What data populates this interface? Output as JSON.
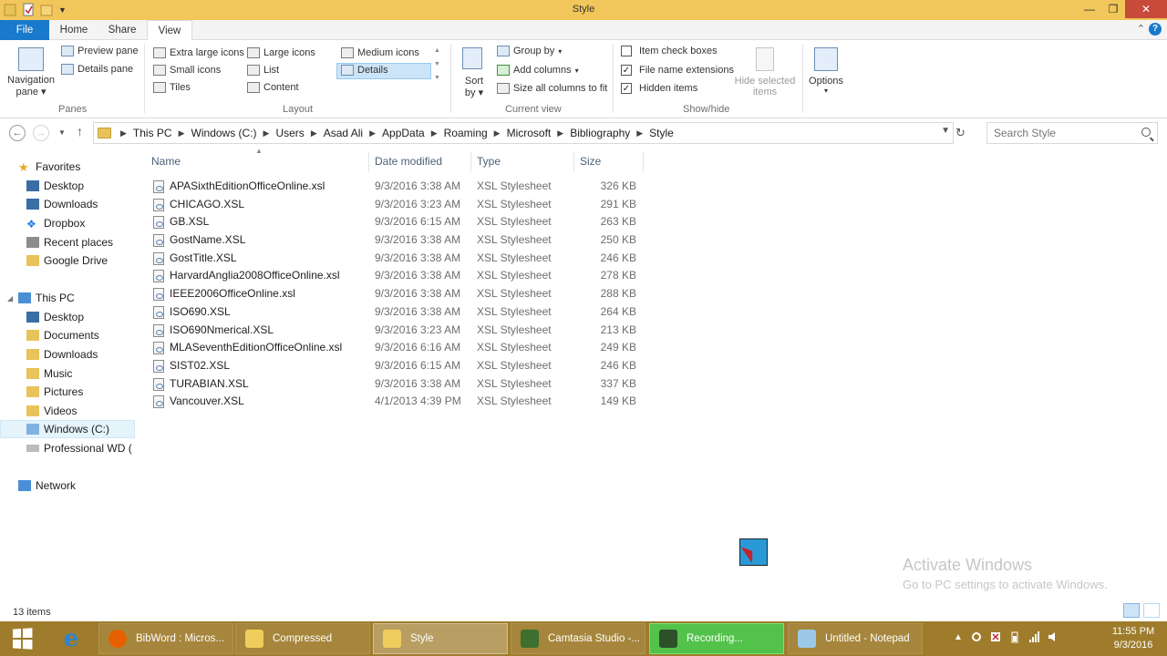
{
  "window": {
    "title": "Style"
  },
  "ribbon": {
    "tabs": [
      "File",
      "Home",
      "Share",
      "View"
    ],
    "panes": {
      "navigation_pane": "Navigation",
      "navigation_pane_line2": "pane",
      "preview_pane": "Preview pane",
      "details_pane": "Details pane",
      "group_label": "Panes"
    },
    "layout": {
      "extra_large_icons": "Extra large icons",
      "large_icons": "Large icons",
      "medium_icons": "Medium icons",
      "small_icons": "Small icons",
      "list": "List",
      "details": "Details",
      "tiles": "Tiles",
      "content": "Content",
      "group_label": "Layout",
      "selected": "Details"
    },
    "current_view": {
      "sort_by": "Sort",
      "sort_by_line2": "by",
      "group_by": "Group by",
      "add_columns": "Add columns",
      "size_all_columns": "Size all columns to fit",
      "group_label": "Current view"
    },
    "show_hide": {
      "item_check_boxes": "Item check boxes",
      "item_check_boxes_checked": false,
      "file_name_extensions": "File name extensions",
      "file_name_extensions_checked": true,
      "hidden_items": "Hidden items",
      "hidden_items_checked": true,
      "hide_selected_items": "Hide selected",
      "hide_selected_items_line2": "items",
      "group_label": "Show/hide"
    },
    "options": "Options"
  },
  "address": {
    "breadcrumbs": [
      "This PC",
      "Windows (C:)",
      "Users",
      "Asad Ali",
      "AppData",
      "Roaming",
      "Microsoft",
      "Bibliography",
      "Style"
    ],
    "search_placeholder": "Search Style"
  },
  "nav": {
    "favorites": "Favorites",
    "favorites_items": [
      "Desktop",
      "Downloads",
      "Dropbox",
      "Recent places",
      "Google Drive"
    ],
    "this_pc": "This PC",
    "this_pc_items": [
      "Desktop",
      "Documents",
      "Downloads",
      "Music",
      "Pictures",
      "Videos",
      "Windows (C:)",
      "Professional WD ("
    ],
    "selected": "Windows (C:)",
    "network": "Network"
  },
  "columns": {
    "name": "Name",
    "date_modified": "Date modified",
    "type": "Type",
    "size": "Size"
  },
  "files": [
    {
      "name": "APASixthEditionOfficeOnline.xsl",
      "date": "9/3/2016 3:38 AM",
      "type": "XSL Stylesheet",
      "size": "326 KB"
    },
    {
      "name": "CHICAGO.XSL",
      "date": "9/3/2016 3:23 AM",
      "type": "XSL Stylesheet",
      "size": "291 KB"
    },
    {
      "name": "GB.XSL",
      "date": "9/3/2016 6:15 AM",
      "type": "XSL Stylesheet",
      "size": "263 KB"
    },
    {
      "name": "GostName.XSL",
      "date": "9/3/2016 3:38 AM",
      "type": "XSL Stylesheet",
      "size": "250 KB"
    },
    {
      "name": "GostTitle.XSL",
      "date": "9/3/2016 3:38 AM",
      "type": "XSL Stylesheet",
      "size": "246 KB"
    },
    {
      "name": "HarvardAnglia2008OfficeOnline.xsl",
      "date": "9/3/2016 3:38 AM",
      "type": "XSL Stylesheet",
      "size": "278 KB"
    },
    {
      "name": "IEEE2006OfficeOnline.xsl",
      "date": "9/3/2016 3:38 AM",
      "type": "XSL Stylesheet",
      "size": "288 KB"
    },
    {
      "name": "ISO690.XSL",
      "date": "9/3/2016 3:38 AM",
      "type": "XSL Stylesheet",
      "size": "264 KB"
    },
    {
      "name": "ISO690Nmerical.XSL",
      "date": "9/3/2016 3:23 AM",
      "type": "XSL Stylesheet",
      "size": "213 KB"
    },
    {
      "name": "MLASeventhEditionOfficeOnline.xsl",
      "date": "9/3/2016 6:16 AM",
      "type": "XSL Stylesheet",
      "size": "249 KB"
    },
    {
      "name": "SIST02.XSL",
      "date": "9/3/2016 6:15 AM",
      "type": "XSL Stylesheet",
      "size": "246 KB"
    },
    {
      "name": "TURABIAN.XSL",
      "date": "9/3/2016 3:38 AM",
      "type": "XSL Stylesheet",
      "size": "337 KB"
    },
    {
      "name": "Vancouver.XSL",
      "date": "4/1/2013 4:39 PM",
      "type": "XSL Stylesheet",
      "size": "149 KB"
    }
  ],
  "status": {
    "item_count": "13 items"
  },
  "watermark": {
    "line1": "Activate Windows",
    "line2": "Go to PC settings to activate Windows."
  },
  "taskbar": {
    "apps": [
      {
        "label": "BibWord : Micros...",
        "icon": "firefox-icon"
      },
      {
        "label": "Compressed",
        "icon": "folder-icon"
      },
      {
        "label": "Style",
        "icon": "folder-icon"
      },
      {
        "label": "Camtasia Studio -...",
        "icon": "camtasia-icon"
      },
      {
        "label": "Recording...",
        "icon": "recorder-icon"
      },
      {
        "label": "Untitled - Notepad",
        "icon": "notepad-icon"
      }
    ],
    "clock_time": "11:55 PM",
    "clock_date": "9/3/2016"
  },
  "colors": {
    "title_bar": "#f1c65a",
    "file_tab": "#1979ca",
    "taskbar": "#9f7c2c",
    "recording_task": "#52c24a"
  }
}
